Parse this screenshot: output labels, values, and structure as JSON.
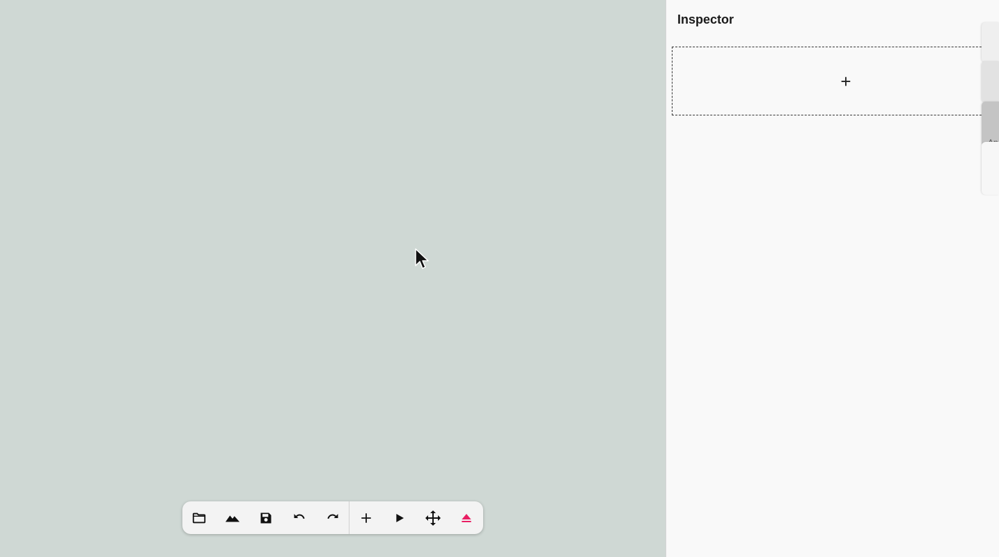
{
  "inspector": {
    "title": "Inspector",
    "add_zone_symbol": "+"
  },
  "side_tabs": [
    {
      "label": "",
      "color": "#efefef"
    },
    {
      "label": "",
      "color": "#e2e2e2"
    },
    {
      "label": "An",
      "color": "#c4c4c4"
    },
    {
      "label": "",
      "color": "#f7f7f7"
    }
  ],
  "toolbar": {
    "buttons": [
      {
        "name": "open-folder",
        "icon": "folder-icon"
      },
      {
        "name": "terrain",
        "icon": "terrain-icon"
      },
      {
        "name": "save",
        "icon": "save-icon"
      },
      {
        "name": "undo",
        "icon": "undo-icon"
      },
      {
        "name": "redo",
        "icon": "redo-icon"
      },
      {
        "name": "add",
        "icon": "plus-icon"
      },
      {
        "name": "play",
        "icon": "play-icon"
      },
      {
        "name": "move",
        "icon": "move-icon"
      },
      {
        "name": "eject",
        "icon": "eject-icon"
      }
    ],
    "accent_color": "#e91e63"
  },
  "canvas": {
    "background": "#cfd8d4"
  }
}
